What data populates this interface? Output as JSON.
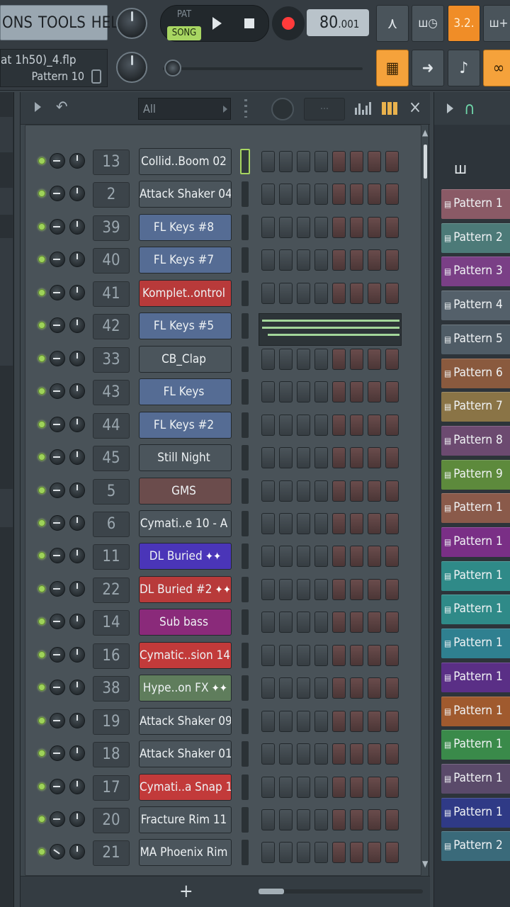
{
  "menu": {
    "items": [
      "ONS",
      "TOOLS",
      "HELP"
    ]
  },
  "transport": {
    "pat_label": "PAT",
    "song_label": "SONG",
    "tempo_main": "80",
    "tempo_decimal": ".001"
  },
  "project": {
    "file_name": "at 1h50)_4.flp",
    "pattern": "Pattern 10"
  },
  "toolbar_buttons": {
    "tb1": "⋏",
    "tb2": "ш◷",
    "tb3": "3.2.",
    "tb4": "ш+",
    "tb5": "▦",
    "tb6": "➜",
    "tb7": "♪",
    "tb8": "∞"
  },
  "rack": {
    "filter": "All",
    "swing": "···",
    "channels": [
      {
        "num": "13",
        "name": "Collid..Boom 02",
        "color": "#4b555c",
        "wave": ""
      },
      {
        "num": "2",
        "name": "Attack Shaker 04",
        "color": "#4b555c",
        "wave": ""
      },
      {
        "num": "39",
        "name": "FL Keys #8",
        "color": "#556c94",
        "wave": ""
      },
      {
        "num": "40",
        "name": "FL Keys #7",
        "color": "#556c94",
        "wave": ""
      },
      {
        "num": "41",
        "name": "Komplet..ontrol",
        "color": "#b83a3a",
        "wave": ""
      },
      {
        "num": "42",
        "name": "FL Keys #5",
        "color": "#556c94",
        "wave": ""
      },
      {
        "num": "33",
        "name": "CB_Clap",
        "color": "#4b555c",
        "wave": ""
      },
      {
        "num": "43",
        "name": "FL Keys",
        "color": "#556c94",
        "wave": ""
      },
      {
        "num": "44",
        "name": "FL Keys #2",
        "color": "#556c94",
        "wave": ""
      },
      {
        "num": "45",
        "name": "Still Night",
        "color": "#4b555c",
        "wave": ""
      },
      {
        "num": "5",
        "name": "GMS",
        "color": "#6b4c4c",
        "wave": ""
      },
      {
        "num": "6",
        "name": "Cymati..e 10 - A",
        "color": "#4b555c",
        "wave": ""
      },
      {
        "num": "11",
        "name": "DL Buried",
        "color": "#4a35b8",
        "wave": "✦✦"
      },
      {
        "num": "22",
        "name": "DL Buried #2",
        "color": "#b83a3a",
        "wave": "✦✦"
      },
      {
        "num": "14",
        "name": "Sub bass",
        "color": "#8a2a7a",
        "wave": ""
      },
      {
        "num": "16",
        "name": "Cymatic..sion 14",
        "color": "#c23a3a",
        "wave": ""
      },
      {
        "num": "38",
        "name": "Hype..on FX",
        "color": "#5f7d5c",
        "wave": "✦✦"
      },
      {
        "num": "19",
        "name": "Attack Shaker 09",
        "color": "#4b555c",
        "wave": ""
      },
      {
        "num": "18",
        "name": "Attack Shaker 01",
        "color": "#4b555c",
        "wave": ""
      },
      {
        "num": "17",
        "name": "Cymati..a Snap 1",
        "color": "#c23a3a",
        "wave": ""
      },
      {
        "num": "20",
        "name": "Fracture Rim 11",
        "color": "#4b555c",
        "wave": ""
      },
      {
        "num": "21",
        "name": "MA Phoenix Rim",
        "color": "#4b555c",
        "wave": ""
      }
    ]
  },
  "playlist": {
    "patterns": [
      {
        "label": "Pattern 1",
        "color": "#8a5a66"
      },
      {
        "label": "Pattern 2",
        "color": "#4c7a78"
      },
      {
        "label": "Pattern 3",
        "color": "#7a3f86"
      },
      {
        "label": "Pattern 4",
        "color": "#54606a"
      },
      {
        "label": "Pattern 5",
        "color": "#4f5c66"
      },
      {
        "label": "Pattern 6",
        "color": "#8a5a3e"
      },
      {
        "label": "Pattern 7",
        "color": "#8a7446"
      },
      {
        "label": "Pattern 8",
        "color": "#6c4a70"
      },
      {
        "label": "Pattern 9",
        "color": "#5d8a3c"
      },
      {
        "label": "Pattern 1",
        "color": "#8a5a4a"
      },
      {
        "label": "Pattern 1",
        "color": "#7a2f86"
      },
      {
        "label": "Pattern 1",
        "color": "#2f8a88"
      },
      {
        "label": "Pattern 1",
        "color": "#2f8a88"
      },
      {
        "label": "Pattern 1",
        "color": "#2f8090"
      },
      {
        "label": "Pattern 1",
        "color": "#5a2f86"
      },
      {
        "label": "Pattern 1",
        "color": "#a05a2e"
      },
      {
        "label": "Pattern 1",
        "color": "#3a8a4a"
      },
      {
        "label": "Pattern 1",
        "color": "#5a4a6a"
      },
      {
        "label": "Pattern 1",
        "color": "#2f3a86"
      },
      {
        "label": "Pattern 2",
        "color": "#3a6a7a"
      }
    ]
  }
}
